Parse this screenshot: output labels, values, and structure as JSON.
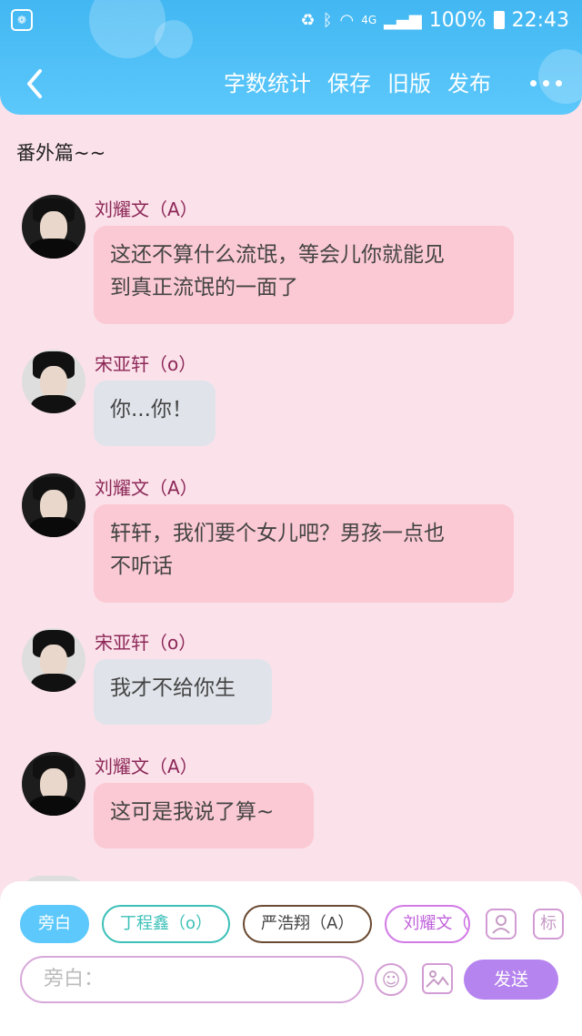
{
  "colors": {
    "header": "#4bbef6",
    "background": "#fbe1ea",
    "name": "#8c2857",
    "send": "#b584ee"
  },
  "status": {
    "battery": "100%",
    "time": "22:43",
    "network": "4G"
  },
  "nav": {
    "items": [
      "字数统计",
      "保存",
      "旧版",
      "发布"
    ]
  },
  "chapter_title": "番外篇~~",
  "messages": [
    {
      "name": "刘耀文（A）",
      "text_lines": [
        "这还不算什么流氓，等会儿你就能见",
        "到真正流氓的一面了"
      ]
    },
    {
      "name": "宋亚轩（o）",
      "text_lines": [
        "你...你！"
      ]
    },
    {
      "name": "刘耀文（A）",
      "text_lines": [
        "轩轩，我们要个女儿吧？男孩一点也",
        "不听话"
      ]
    },
    {
      "name": "宋亚轩（o）",
      "text_lines": [
        "我才不给你生"
      ]
    },
    {
      "name": "刘耀文（A）",
      "text_lines": [
        "这可是我说了算~"
      ]
    }
  ],
  "composer": {
    "roles": [
      "旁白",
      "丁程鑫（o）",
      "严浩翔（A）",
      "刘耀文（A）"
    ],
    "tool_label": "标",
    "placeholder": "旁白：",
    "send": "发送"
  }
}
